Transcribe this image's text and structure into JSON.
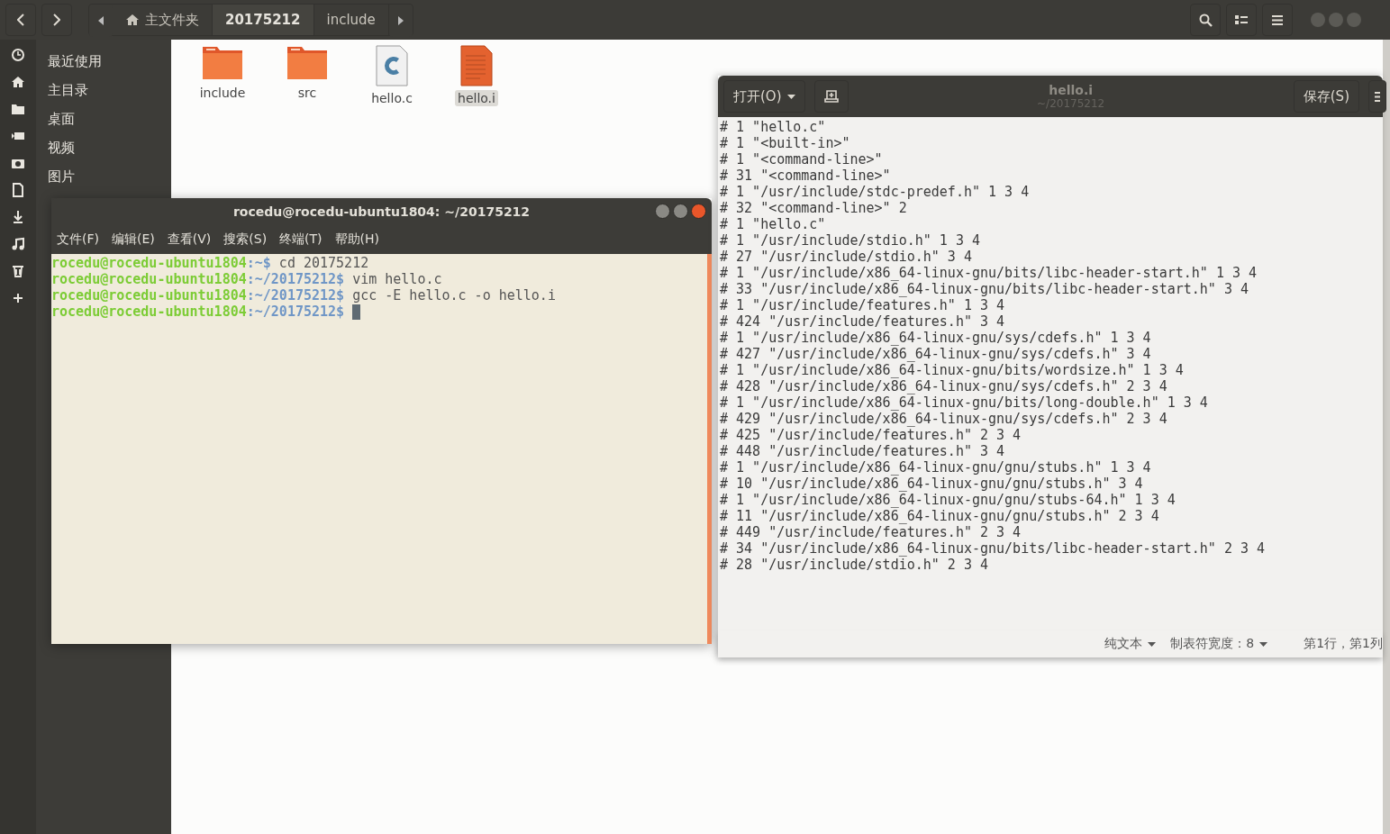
{
  "toolbar": {
    "path": [
      {
        "label": "主文件夹",
        "kind": "home",
        "selected": false
      },
      {
        "label": "20175212",
        "kind": "folder",
        "selected": true
      },
      {
        "label": "include",
        "kind": "folder",
        "selected": false
      }
    ]
  },
  "sidebar": {
    "items": [
      {
        "label": "最近使用"
      },
      {
        "label": "主目录"
      },
      {
        "label": "桌面"
      },
      {
        "label": "视频"
      },
      {
        "label": "图片"
      }
    ]
  },
  "files": [
    {
      "name": "include",
      "kind": "folder",
      "selected": false
    },
    {
      "name": "src",
      "kind": "folder",
      "selected": false
    },
    {
      "name": "hello.c",
      "kind": "csource",
      "selected": false
    },
    {
      "name": "hello.i",
      "kind": "text",
      "selected": true
    }
  ],
  "terminal": {
    "title": "rocedu@rocedu-ubuntu1804: ~/20175212",
    "menu": [
      "文件(F)",
      "编辑(E)",
      "查看(V)",
      "搜索(S)",
      "终端(T)",
      "帮助(H)"
    ],
    "lines": [
      {
        "user": "rocedu@rocedu-ubuntu1804",
        "path": ":~",
        "prompt": "$",
        "command": " cd 20175212"
      },
      {
        "user": "rocedu@rocedu-ubuntu1804",
        "path": ":~/20175212",
        "prompt": "$",
        "command": " vim hello.c"
      },
      {
        "user": "rocedu@rocedu-ubuntu1804",
        "path": ":~/20175212",
        "prompt": "$",
        "command": " gcc -E hello.c -o hello.i"
      },
      {
        "user": "rocedu@rocedu-ubuntu1804",
        "path": ":~/20175212",
        "prompt": "$",
        "cursor": true
      }
    ]
  },
  "editor": {
    "open_button": "打开(O)",
    "title": "hello.i",
    "subtitle": "~/20175212",
    "save_button": "保存(S)",
    "lines": [
      "# 1 \"hello.c\"",
      "# 1 \"<built-in>\"",
      "# 1 \"<command-line>\"",
      "# 31 \"<command-line>\"",
      "# 1 \"/usr/include/stdc-predef.h\" 1 3 4",
      "# 32 \"<command-line>\" 2",
      "# 1 \"hello.c\"",
      "# 1 \"/usr/include/stdio.h\" 1 3 4",
      "# 27 \"/usr/include/stdio.h\" 3 4",
      "# 1 \"/usr/include/x86_64-linux-gnu/bits/libc-header-start.h\" 1 3 4",
      "# 33 \"/usr/include/x86_64-linux-gnu/bits/libc-header-start.h\" 3 4",
      "# 1 \"/usr/include/features.h\" 1 3 4",
      "# 424 \"/usr/include/features.h\" 3 4",
      "# 1 \"/usr/include/x86_64-linux-gnu/sys/cdefs.h\" 1 3 4",
      "# 427 \"/usr/include/x86_64-linux-gnu/sys/cdefs.h\" 3 4",
      "# 1 \"/usr/include/x86_64-linux-gnu/bits/wordsize.h\" 1 3 4",
      "# 428 \"/usr/include/x86_64-linux-gnu/sys/cdefs.h\" 2 3 4",
      "# 1 \"/usr/include/x86_64-linux-gnu/bits/long-double.h\" 1 3 4",
      "# 429 \"/usr/include/x86_64-linux-gnu/sys/cdefs.h\" 2 3 4",
      "# 425 \"/usr/include/features.h\" 2 3 4",
      "# 448 \"/usr/include/features.h\" 3 4",
      "# 1 \"/usr/include/x86_64-linux-gnu/gnu/stubs.h\" 1 3 4",
      "# 10 \"/usr/include/x86_64-linux-gnu/gnu/stubs.h\" 3 4",
      "# 1 \"/usr/include/x86_64-linux-gnu/gnu/stubs-64.h\" 1 3 4",
      "# 11 \"/usr/include/x86_64-linux-gnu/gnu/stubs.h\" 2 3 4",
      "# 449 \"/usr/include/features.h\" 2 3 4",
      "# 34 \"/usr/include/x86_64-linux-gnu/bits/libc-header-start.h\" 2 3 4",
      "# 28 \"/usr/include/stdio.h\" 2 3 4"
    ],
    "status": {
      "language": "纯文本",
      "tab_width": "制表符宽度：8",
      "position": "第1行，第1列"
    }
  }
}
